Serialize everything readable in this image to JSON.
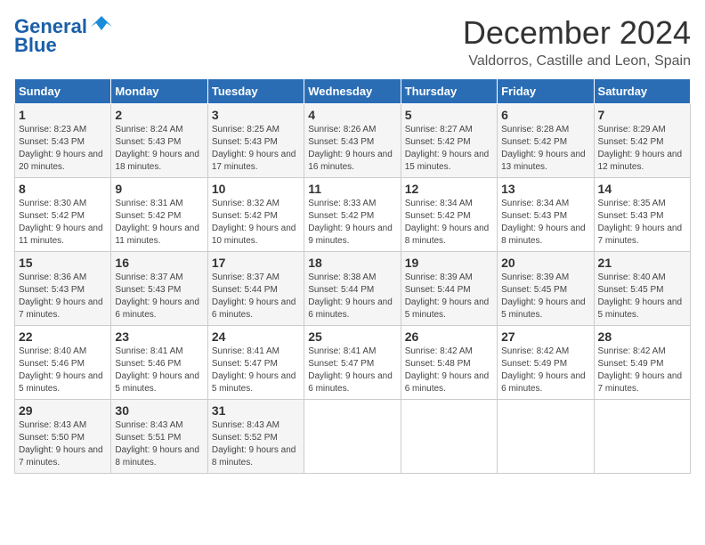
{
  "logo": {
    "line1": "General",
    "line2": "Blue"
  },
  "title": "December 2024",
  "location": "Valdorros, Castille and Leon, Spain",
  "days_of_week": [
    "Sunday",
    "Monday",
    "Tuesday",
    "Wednesday",
    "Thursday",
    "Friday",
    "Saturday"
  ],
  "weeks": [
    [
      {
        "day": 1,
        "sunrise": "8:23 AM",
        "sunset": "5:43 PM",
        "daylight": "9 hours and 20 minutes."
      },
      {
        "day": 2,
        "sunrise": "8:24 AM",
        "sunset": "5:43 PM",
        "daylight": "9 hours and 18 minutes."
      },
      {
        "day": 3,
        "sunrise": "8:25 AM",
        "sunset": "5:43 PM",
        "daylight": "9 hours and 17 minutes."
      },
      {
        "day": 4,
        "sunrise": "8:26 AM",
        "sunset": "5:43 PM",
        "daylight": "9 hours and 16 minutes."
      },
      {
        "day": 5,
        "sunrise": "8:27 AM",
        "sunset": "5:42 PM",
        "daylight": "9 hours and 15 minutes."
      },
      {
        "day": 6,
        "sunrise": "8:28 AM",
        "sunset": "5:42 PM",
        "daylight": "9 hours and 13 minutes."
      },
      {
        "day": 7,
        "sunrise": "8:29 AM",
        "sunset": "5:42 PM",
        "daylight": "9 hours and 12 minutes."
      }
    ],
    [
      {
        "day": 8,
        "sunrise": "8:30 AM",
        "sunset": "5:42 PM",
        "daylight": "9 hours and 11 minutes."
      },
      {
        "day": 9,
        "sunrise": "8:31 AM",
        "sunset": "5:42 PM",
        "daylight": "9 hours and 11 minutes."
      },
      {
        "day": 10,
        "sunrise": "8:32 AM",
        "sunset": "5:42 PM",
        "daylight": "9 hours and 10 minutes."
      },
      {
        "day": 11,
        "sunrise": "8:33 AM",
        "sunset": "5:42 PM",
        "daylight": "9 hours and 9 minutes."
      },
      {
        "day": 12,
        "sunrise": "8:34 AM",
        "sunset": "5:42 PM",
        "daylight": "9 hours and 8 minutes."
      },
      {
        "day": 13,
        "sunrise": "8:34 AM",
        "sunset": "5:43 PM",
        "daylight": "9 hours and 8 minutes."
      },
      {
        "day": 14,
        "sunrise": "8:35 AM",
        "sunset": "5:43 PM",
        "daylight": "9 hours and 7 minutes."
      }
    ],
    [
      {
        "day": 15,
        "sunrise": "8:36 AM",
        "sunset": "5:43 PM",
        "daylight": "9 hours and 7 minutes."
      },
      {
        "day": 16,
        "sunrise": "8:37 AM",
        "sunset": "5:43 PM",
        "daylight": "9 hours and 6 minutes."
      },
      {
        "day": 17,
        "sunrise": "8:37 AM",
        "sunset": "5:44 PM",
        "daylight": "9 hours and 6 minutes."
      },
      {
        "day": 18,
        "sunrise": "8:38 AM",
        "sunset": "5:44 PM",
        "daylight": "9 hours and 6 minutes."
      },
      {
        "day": 19,
        "sunrise": "8:39 AM",
        "sunset": "5:44 PM",
        "daylight": "9 hours and 5 minutes."
      },
      {
        "day": 20,
        "sunrise": "8:39 AM",
        "sunset": "5:45 PM",
        "daylight": "9 hours and 5 minutes."
      },
      {
        "day": 21,
        "sunrise": "8:40 AM",
        "sunset": "5:45 PM",
        "daylight": "9 hours and 5 minutes."
      }
    ],
    [
      {
        "day": 22,
        "sunrise": "8:40 AM",
        "sunset": "5:46 PM",
        "daylight": "9 hours and 5 minutes."
      },
      {
        "day": 23,
        "sunrise": "8:41 AM",
        "sunset": "5:46 PM",
        "daylight": "9 hours and 5 minutes."
      },
      {
        "day": 24,
        "sunrise": "8:41 AM",
        "sunset": "5:47 PM",
        "daylight": "9 hours and 5 minutes."
      },
      {
        "day": 25,
        "sunrise": "8:41 AM",
        "sunset": "5:47 PM",
        "daylight": "9 hours and 6 minutes."
      },
      {
        "day": 26,
        "sunrise": "8:42 AM",
        "sunset": "5:48 PM",
        "daylight": "9 hours and 6 minutes."
      },
      {
        "day": 27,
        "sunrise": "8:42 AM",
        "sunset": "5:49 PM",
        "daylight": "9 hours and 6 minutes."
      },
      {
        "day": 28,
        "sunrise": "8:42 AM",
        "sunset": "5:49 PM",
        "daylight": "9 hours and 7 minutes."
      }
    ],
    [
      {
        "day": 29,
        "sunrise": "8:43 AM",
        "sunset": "5:50 PM",
        "daylight": "9 hours and 7 minutes."
      },
      {
        "day": 30,
        "sunrise": "8:43 AM",
        "sunset": "5:51 PM",
        "daylight": "9 hours and 8 minutes."
      },
      {
        "day": 31,
        "sunrise": "8:43 AM",
        "sunset": "5:52 PM",
        "daylight": "9 hours and 8 minutes."
      },
      null,
      null,
      null,
      null
    ]
  ],
  "labels": {
    "sunrise": "Sunrise:",
    "sunset": "Sunset:",
    "daylight": "Daylight:"
  }
}
